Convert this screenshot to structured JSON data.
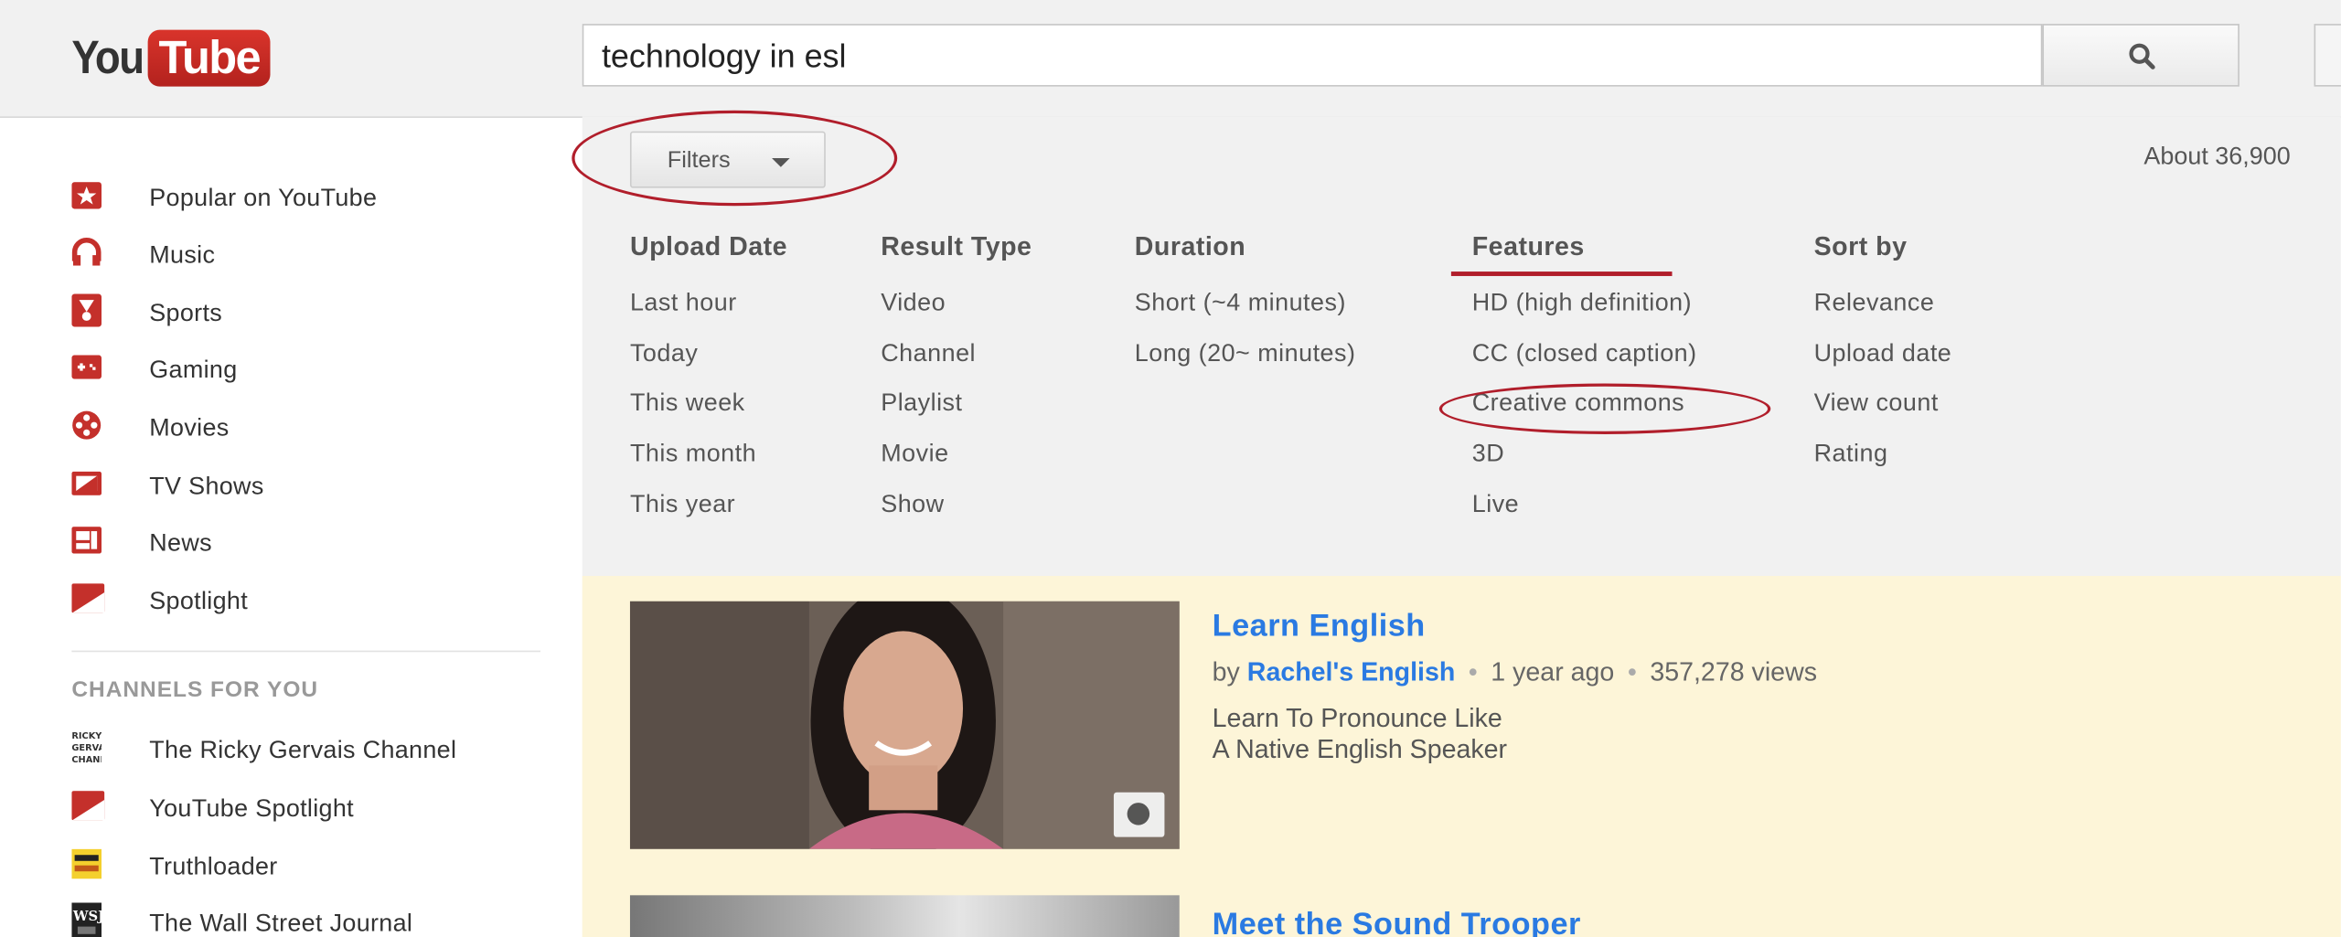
{
  "header": {
    "logo_you": "You",
    "logo_tube": "Tube",
    "search_value": "technology in esl"
  },
  "sidebar": {
    "items": [
      {
        "label": "Popular on YouTube",
        "icon": "star-icon"
      },
      {
        "label": "Music",
        "icon": "headphones-icon"
      },
      {
        "label": "Sports",
        "icon": "trophy-icon"
      },
      {
        "label": "Gaming",
        "icon": "gamepad-icon"
      },
      {
        "label": "Movies",
        "icon": "film-reel-icon"
      },
      {
        "label": "TV Shows",
        "icon": "tv-icon"
      },
      {
        "label": "News",
        "icon": "newspaper-icon"
      },
      {
        "label": "Spotlight",
        "icon": "spotlight-icon"
      }
    ],
    "channels_heading": "CHANNELS FOR YOU",
    "channels": [
      {
        "label": "The Ricky Gervais Channel",
        "icon": "ricky-gervais-channel-icon"
      },
      {
        "label": "YouTube Spotlight",
        "icon": "spotlight-icon"
      },
      {
        "label": "Truthloader",
        "icon": "truthloader-icon"
      },
      {
        "label": "The Wall Street Journal",
        "icon": "wsj-icon"
      }
    ]
  },
  "filters": {
    "button_label": "Filters",
    "about_text": "About 36,900",
    "columns": [
      {
        "heading": "Upload Date",
        "items": [
          "Last hour",
          "Today",
          "This week",
          "This month",
          "This year"
        ]
      },
      {
        "heading": "Result Type",
        "items": [
          "Video",
          "Channel",
          "Playlist",
          "Movie",
          "Show"
        ]
      },
      {
        "heading": "Duration",
        "items": [
          "Short (~4 minutes)",
          "Long (20~ minutes)"
        ]
      },
      {
        "heading": "Features",
        "items": [
          "HD (high definition)",
          "CC (closed caption)",
          "Creative commons",
          "3D",
          "Live"
        ]
      },
      {
        "heading": "Sort by",
        "items": [
          "Relevance",
          "Upload date",
          "View count",
          "Rating"
        ]
      }
    ],
    "annotation_color": "#b11e2b"
  },
  "results": [
    {
      "title": "Learn English",
      "by": "by",
      "channel": "Rachel's English",
      "age": "1 year ago",
      "views": "357,278 views",
      "sep": "•",
      "desc_line1": "Learn To Pronounce Like",
      "desc_line2": "A Native English Speaker"
    },
    {
      "title": "Meet the Sound Trooper"
    }
  ],
  "colors": {
    "link": "#2a7ae2",
    "brand_red": "#c4302b",
    "filter_panel_bg": "#f1f1f1",
    "results_bg": "#fdf5d8"
  }
}
